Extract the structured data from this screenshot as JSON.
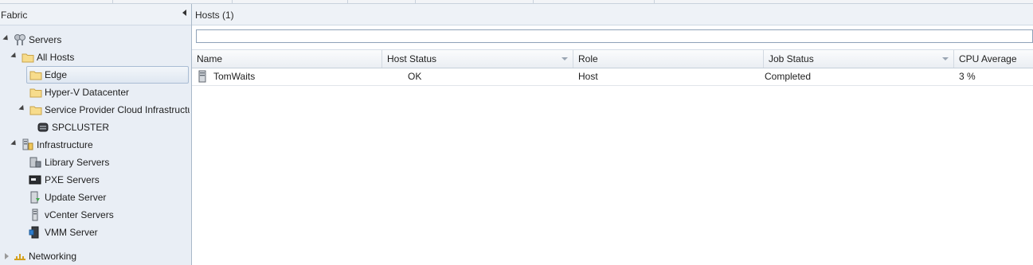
{
  "nav": {
    "title": "Fabric",
    "tree": [
      {
        "id": "servers",
        "label": "Servers",
        "icon": "servers-icon",
        "expanded": true
      },
      {
        "id": "all-hosts",
        "label": "All Hosts",
        "icon": "folder-icon",
        "expanded": true
      },
      {
        "id": "edge",
        "label": "Edge",
        "icon": "folder-icon",
        "selected": true
      },
      {
        "id": "hyperv",
        "label": "Hyper-V Datacenter",
        "icon": "folder-icon"
      },
      {
        "id": "spcloud",
        "label": "Service Provider Cloud Infrastructu",
        "icon": "folder-icon",
        "expanded": true
      },
      {
        "id": "spcluster",
        "label": "SPCLUSTER",
        "icon": "cluster-icon"
      },
      {
        "id": "infrastructure",
        "label": "Infrastructure",
        "icon": "infrastructure-icon",
        "expanded": true
      },
      {
        "id": "library",
        "label": "Library Servers",
        "icon": "library-server-icon"
      },
      {
        "id": "pxe",
        "label": "PXE Servers",
        "icon": "pxe-server-icon"
      },
      {
        "id": "update",
        "label": "Update Server",
        "icon": "update-server-icon"
      },
      {
        "id": "vcenter",
        "label": "vCenter Servers",
        "icon": "vcenter-server-icon"
      },
      {
        "id": "vmm",
        "label": "VMM Server",
        "icon": "vmm-server-icon"
      },
      {
        "id": "networking",
        "label": "Networking",
        "icon": "networking-icon",
        "expanded": false
      }
    ]
  },
  "main": {
    "title": "Hosts (1)",
    "search": {
      "value": "",
      "placeholder": ""
    },
    "columns": [
      "Name",
      "Host Status",
      "Role",
      "Job Status",
      "CPU Average"
    ],
    "rows": [
      {
        "name": "TomWaits",
        "host_status": "OK",
        "role": "Host",
        "job_status": "Completed",
        "cpu_average": "3 %"
      }
    ]
  }
}
